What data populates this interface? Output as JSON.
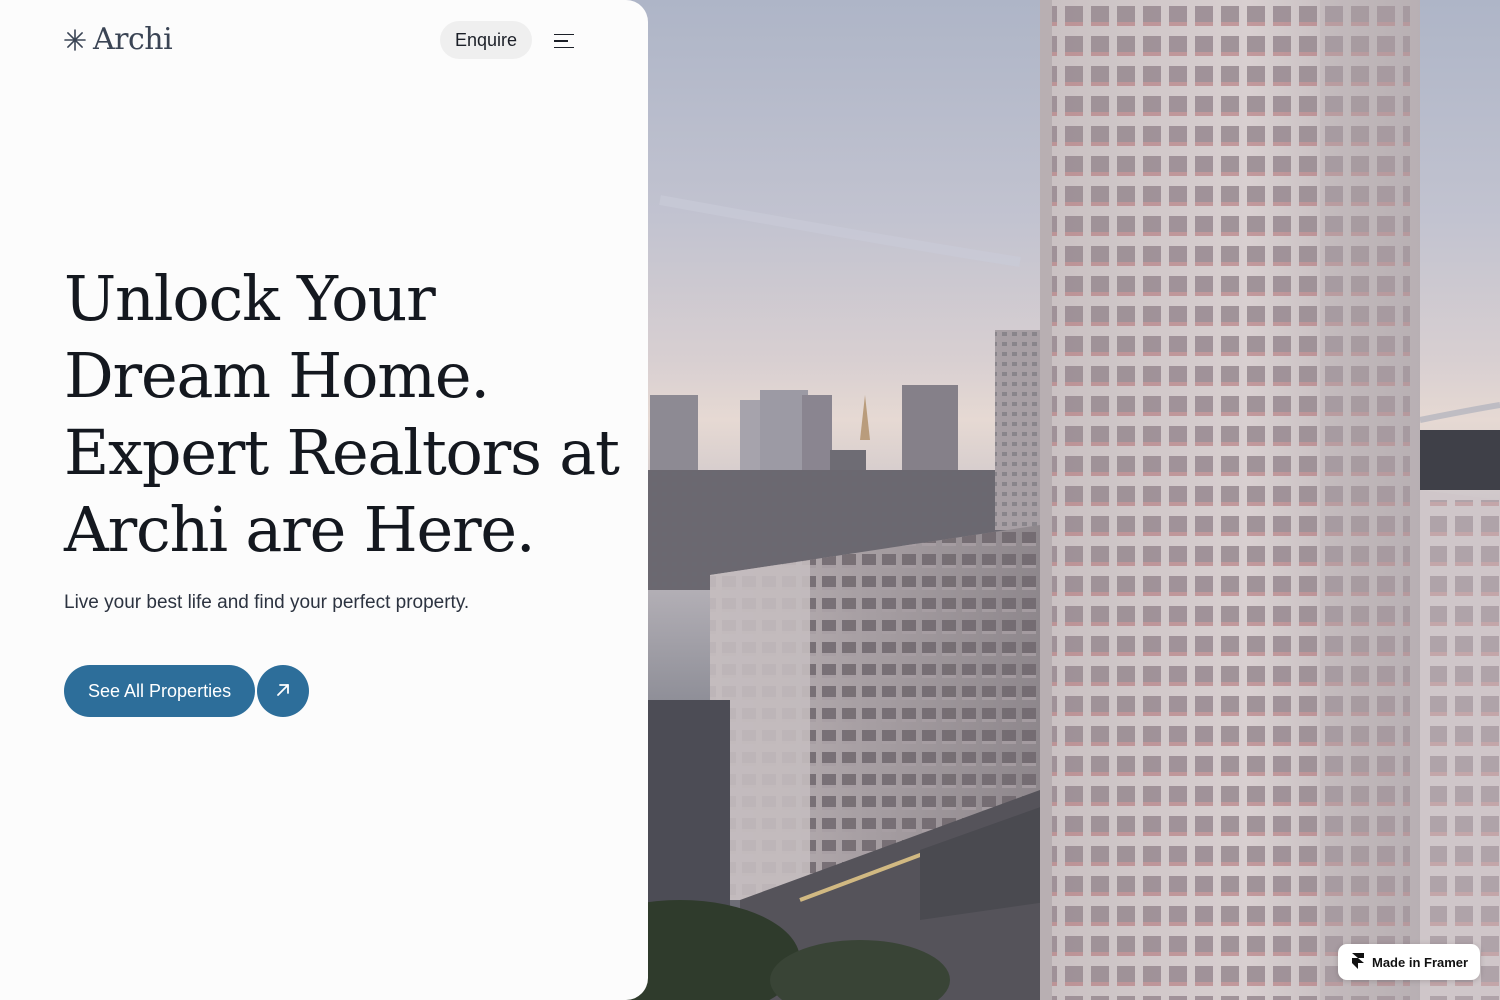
{
  "brand": {
    "name": "Archi",
    "logo_icon": "asterisk-icon"
  },
  "header": {
    "enquire_label": "Enquire",
    "menu_icon": "hamburger-menu-icon"
  },
  "hero": {
    "headline_lines": [
      "Unlock Your",
      "Dream Home.",
      "Expert Realtors at",
      "Archi are Here."
    ],
    "subtitle": "Live your best life and find your perfect property.",
    "cta_label": "See All Properties",
    "cta_icon": "arrow-up-right-icon",
    "image_subject": "city-skyline-photo"
  },
  "badge": {
    "label": "Made in Framer",
    "icon": "framer-logo-icon"
  },
  "colors": {
    "accent": "#2d6e9a",
    "panel_bg": "#fcfcfc",
    "text": "#14181f",
    "enquire_bg": "#efefef"
  }
}
